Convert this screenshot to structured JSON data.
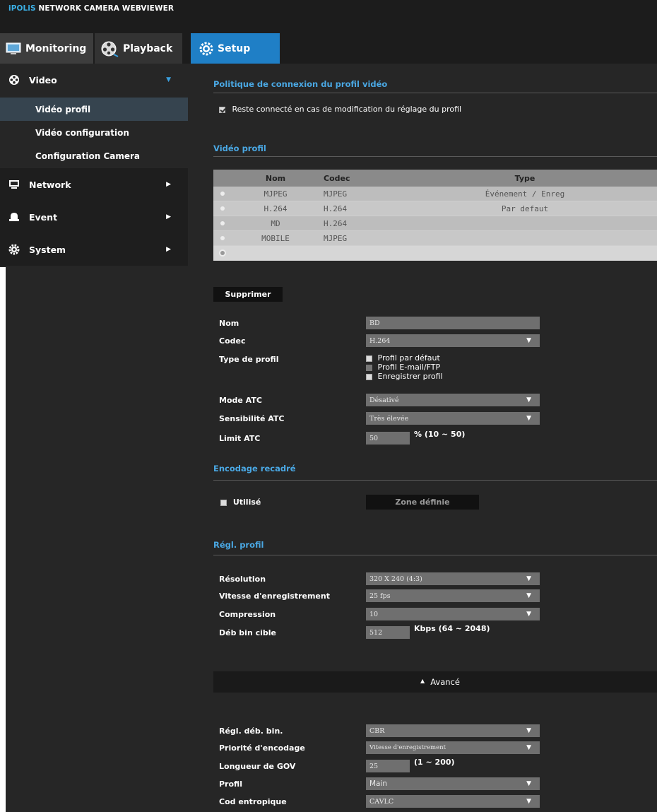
{
  "app": {
    "brand_prefix": "iPOLiS",
    "brand_suffix": "NETWORK CAMERA WEBVIEWER"
  },
  "topnav": [
    {
      "label": "Monitoring",
      "icon": "monitor-icon",
      "active": false
    },
    {
      "label": "Playback",
      "icon": "film-reel-icon",
      "active": false
    },
    {
      "label": "Setup",
      "icon": "gear-icon",
      "active": true
    }
  ],
  "sidebar": {
    "video": {
      "label": "Video",
      "icon": "film-icon",
      "expanded": true,
      "items": [
        {
          "label": "Vidéo profil",
          "active": true
        },
        {
          "label": "Vidéo configuration",
          "active": false
        },
        {
          "label": "Configuration Camera",
          "active": false
        }
      ]
    },
    "network": {
      "label": "Network",
      "icon": "monitor-icon"
    },
    "event": {
      "label": "Event",
      "icon": "bell-icon"
    },
    "system": {
      "label": "System",
      "icon": "gear-icon"
    }
  },
  "connection_policy": {
    "title": "Politique de connexion du profil vidéo",
    "checkbox_label": "Reste connecté en cas de modification du réglage du profil",
    "checked": true
  },
  "video_profile": {
    "title": "Vidéo profil",
    "columns": [
      "Nom",
      "Codec",
      "Type"
    ],
    "rows": [
      {
        "nom": "MJPEG",
        "codec": "MJPEG",
        "type": "Événement / Enreg"
      },
      {
        "nom": "H.264",
        "codec": "H.264",
        "type": "Par defaut"
      },
      {
        "nom": "MD",
        "codec": "H.264",
        "type": ""
      },
      {
        "nom": "MOBILE",
        "codec": "MJPEG",
        "type": ""
      },
      {
        "nom": "",
        "codec": "",
        "type": ""
      }
    ],
    "selected_row": 4,
    "delete_button": "Supprimer"
  },
  "profile_form": {
    "nom_label": "Nom",
    "nom_value": "BD",
    "codec_label": "Codec",
    "codec_value": "H.264",
    "type_label": "Type de profil",
    "type_options": [
      {
        "label": "Profil par défaut",
        "checked": false,
        "disabled": false
      },
      {
        "label": "Profil E-mail/FTP",
        "checked": false,
        "disabled": true
      },
      {
        "label": "Enregistrer profil",
        "checked": false,
        "disabled": false
      }
    ],
    "atc_mode_label": "Mode ATC",
    "atc_mode_value": "Désativé",
    "atc_sens_label": "Sensibilité ATC",
    "atc_sens_value": "Très élevée",
    "atc_limit_label": "Limit ATC",
    "atc_limit_value": "50",
    "atc_limit_range": "% (10 ~ 50)"
  },
  "crop_encoding": {
    "title": "Encodage recadré",
    "used_label": "Utilisé",
    "used_checked": false,
    "zone_button": "Zone définie"
  },
  "profile_settings": {
    "title": "Régl. profil",
    "resolution_label": "Résolution",
    "resolution_value": "320 X 240 (4:3)",
    "fps_label": "Vitesse d'enregistrement",
    "fps_value": "25 fps",
    "compression_label": "Compression",
    "compression_value": "10",
    "bitrate_label": "Déb bin cible",
    "bitrate_value": "512",
    "bitrate_range": "Kbps (64 ~ 2048)"
  },
  "advanced": {
    "toggle_label": "Avancé",
    "bitrate_ctrl_label": "Régl. déb. bin.",
    "bitrate_ctrl_value": "CBR",
    "priority_label": "Priorité d'encodage",
    "priority_value": "Vitesse d'enregistrement",
    "gov_label": "Longueur de GOV",
    "gov_value": "25",
    "gov_range": "(1 ~ 200)",
    "profile_label": "Profil",
    "profile_value": "Main",
    "entropy_label": "Cod entropique",
    "entropy_value": "CAVLC"
  },
  "colors": {
    "accent": "#1f7fc6",
    "title_blue": "#4aa8e4",
    "background": "#262626"
  }
}
